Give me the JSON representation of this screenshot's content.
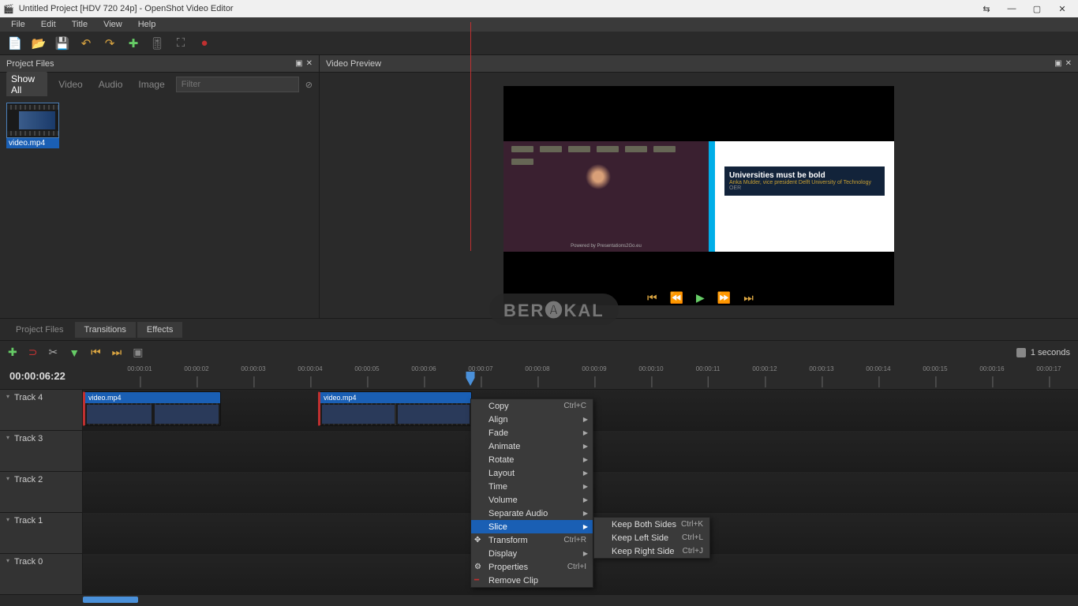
{
  "title": "Untitled Project [HDV 720 24p] - OpenShot Video Editor",
  "menus": [
    "File",
    "Edit",
    "Title",
    "View",
    "Help"
  ],
  "panels": {
    "project": "Project Files",
    "preview": "Video Preview"
  },
  "filters": {
    "all": "Show All",
    "video": "Video",
    "audio": "Audio",
    "image": "Image",
    "placeholder": "Filter"
  },
  "media": {
    "name": "video.mp4"
  },
  "slide": {
    "title": "Universities must be bold",
    "sub": "Anka Mulder, vice president Delft University of Technology",
    "org": "OER",
    "footer": "Powered by Presentations2Go.eu"
  },
  "watermark": "BER🅐KAL",
  "tabs": {
    "files": "Project Files",
    "trans": "Transitions",
    "effects": "Effects"
  },
  "snap": "1 seconds",
  "timecode": "00:00:06:22",
  "ticks": [
    "00:00:01",
    "00:00:02",
    "00:00:03",
    "00:00:04",
    "00:00:05",
    "00:00:06",
    "00:00:07",
    "00:00:08",
    "00:00:09",
    "00:00:10",
    "00:00:11",
    "00:00:12",
    "00:00:13",
    "00:00:14",
    "00:00:15",
    "00:00:16",
    "00:00:17"
  ],
  "tracks": [
    "Track 4",
    "Track 3",
    "Track 2",
    "Track 1",
    "Track 0"
  ],
  "clips": {
    "a": "video.mp4",
    "b": "video.mp4"
  },
  "ctx": {
    "copy": "Copy",
    "copy_sc": "Ctrl+C",
    "align": "Align",
    "fade": "Fade",
    "animate": "Animate",
    "rotate": "Rotate",
    "layout": "Layout",
    "time": "Time",
    "volume": "Volume",
    "sep": "Separate Audio",
    "slice": "Slice",
    "transform": "Transform",
    "transform_sc": "Ctrl+R",
    "display": "Display",
    "props": "Properties",
    "props_sc": "Ctrl+I",
    "remove": "Remove Clip"
  },
  "sub": {
    "both": "Keep Both Sides",
    "both_sc": "Ctrl+K",
    "left": "Keep Left Side",
    "left_sc": "Ctrl+L",
    "right": "Keep Right Side",
    "right_sc": "Ctrl+J"
  }
}
